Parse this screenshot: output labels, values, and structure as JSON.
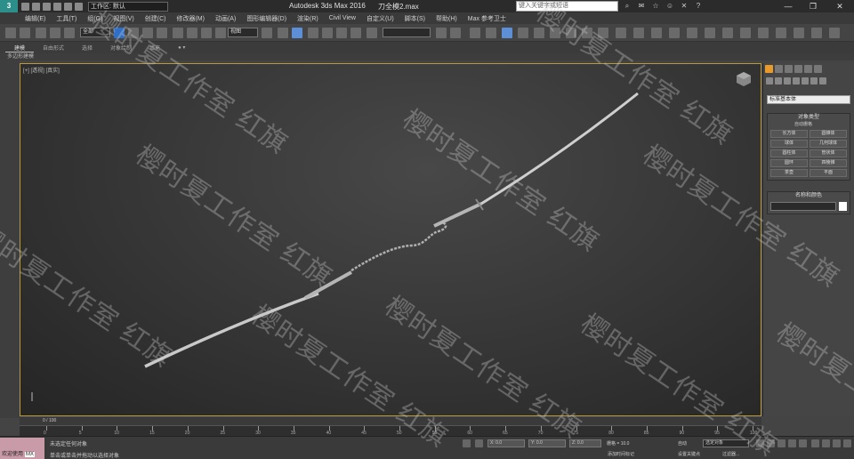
{
  "titlebar": {
    "logo": "3",
    "workspace": "工作区: 默认",
    "app_title": "Autodesk 3ds Max 2016",
    "file_title": "刀全模2.max",
    "search_placeholder": "键入关键字或短语"
  },
  "menu": [
    "编辑(E)",
    "工具(T)",
    "组(G)",
    "视图(V)",
    "创建(C)",
    "修改器(M)",
    "动画(A)",
    "图形编辑器(D)",
    "渲染(R)",
    "Civil View",
    "自定义(U)",
    "脚本(S)",
    "帮助(H)",
    "Max 参考卫士"
  ],
  "toolbar": {
    "selection_filter": "全部",
    "ref_coord": "视图"
  },
  "ribbon": {
    "tabs": [
      "建模",
      "自由形式",
      "选择",
      "对象绘制",
      "填充"
    ],
    "sub_label": "多边形建模"
  },
  "viewport": {
    "label": "[+] [透视] [真实]"
  },
  "command_panel": {
    "dropdown": "标准基本体",
    "object_type_header": "对象类型",
    "autogrid": "自动栅格",
    "buttons": [
      "长方体",
      "圆锥体",
      "球体",
      "几何球体",
      "圆柱体",
      "管状体",
      "圆环",
      "四棱锥",
      "茶壶",
      "平面"
    ],
    "name_color_header": "名称和颜色"
  },
  "timeline": {
    "frame": "0 / 100",
    "ticks": [
      "0",
      "5",
      "10",
      "15",
      "20",
      "25",
      "30",
      "35",
      "40",
      "45",
      "50",
      "55",
      "60",
      "65",
      "70",
      "75",
      "80",
      "85",
      "90",
      "95",
      "100"
    ]
  },
  "status": {
    "welcome": "欢迎使用",
    "maxscript": "MX",
    "line1": "未选定任何对象",
    "line2": "单击或单击并拖动以选择对象",
    "x": "X: 0.0",
    "y": "Y: 0.0",
    "z": "Z: 0.0",
    "grid": "栅格 = 10.0",
    "time_tag": "添加时间标记",
    "autokey": "自动",
    "key_selection": "选定对象",
    "set_key": "设置关键点",
    "key_filter": "过滤器..."
  },
  "watermark": "樱时夏工作室 红旗"
}
